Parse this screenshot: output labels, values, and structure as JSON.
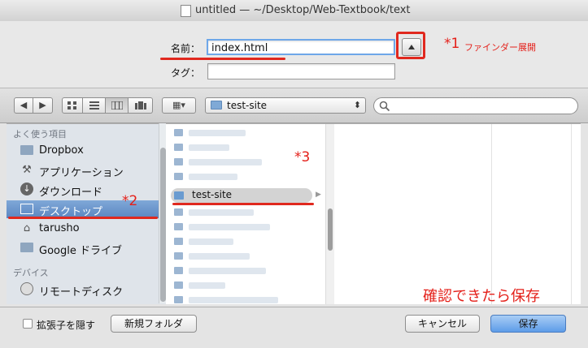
{
  "window": {
    "title": "untitled — ~/Desktop/Web-Textbook/text"
  },
  "form": {
    "name_label": "名前：",
    "name_value": "index.html",
    "tag_label": "タグ：",
    "tag_value": ""
  },
  "annotations": {
    "a1_mark": "*1",
    "a1_text": "ファインダー展開",
    "a2_mark": "*2",
    "a3_mark": "*3",
    "confirm_text": "確認できたら保存"
  },
  "toolbar": {
    "back_icon": "◀",
    "forward_icon": "▶",
    "location": "test-site",
    "popup_arrows": "⬍",
    "action_icon": "▦▾"
  },
  "sidebar": {
    "favorites_header": "よく使う項目",
    "devices_header": "デバイス",
    "items": [
      {
        "label": "Dropbox",
        "icon": "folder-icon"
      },
      {
        "label": "アプリケーション",
        "icon": "applications-icon"
      },
      {
        "label": "ダウンロード",
        "icon": "downloads-icon"
      },
      {
        "label": "デスクトップ",
        "icon": "desktop-icon"
      },
      {
        "label": "tarusho",
        "icon": "home-icon"
      },
      {
        "label": "Google ドライブ",
        "icon": "folder-icon"
      }
    ],
    "devices": [
      {
        "label": "リモートディスク",
        "icon": "disc-icon"
      }
    ]
  },
  "browser": {
    "selected_folder": "test-site"
  },
  "bottom": {
    "hide_ext_label": "拡張子を隠す",
    "new_folder_label": "新規フォルダ",
    "cancel_label": "キャンセル",
    "save_label": "保存"
  },
  "colors": {
    "accent": "#e0281e",
    "selection": "#5b86c2",
    "default_button": "#5d9ce8"
  }
}
